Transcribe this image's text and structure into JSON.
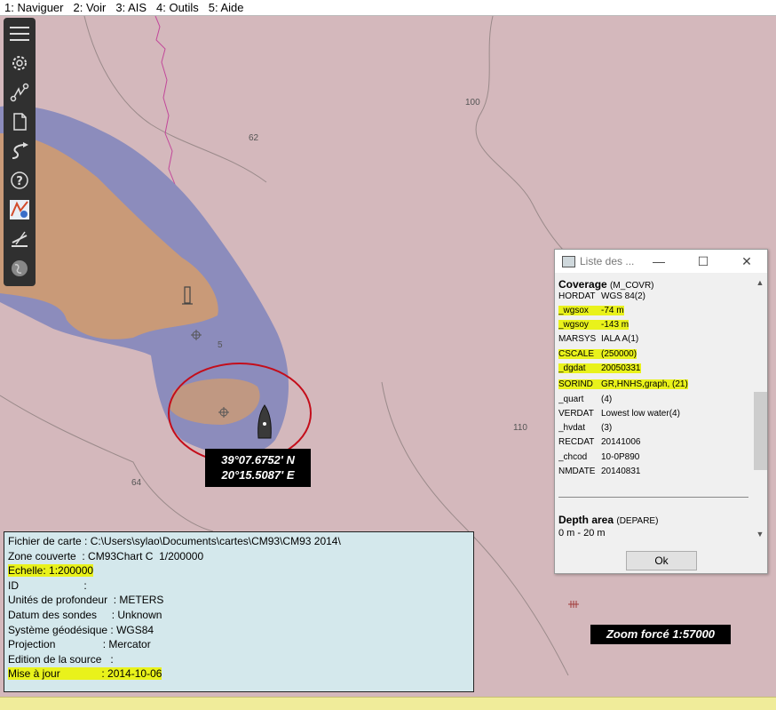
{
  "menu": [
    "1: Naviguer",
    "2: Voir",
    "3: AIS",
    "4: Outils",
    "5: Aide"
  ],
  "toolbar_icons": [
    "menu-icon",
    "settings-icon",
    "route-icon",
    "document-icon",
    "track-icon",
    "help-icon",
    "colors-icon",
    "ais-icon",
    "globe-icon"
  ],
  "map": {
    "depths": [
      "100",
      "62",
      "5",
      "110",
      "64"
    ],
    "position": {
      "lat": "39°07.6752' N",
      "lon": "20°15.5087' E"
    },
    "zoom_label": "Zoom forcé 1:57000"
  },
  "chart_info": {
    "file": "Fichier de carte : C:\\Users\\sylao\\Documents\\cartes\\CM93\\CM93 2014\\",
    "zone": "Zone couverte  : CM93Chart C  1/200000",
    "scale_label": "Echelle: ",
    "scale_value": "1:200000",
    "id": "ID                      :",
    "depth_units": "Unités de profondeur  : METERS",
    "sounding_datum": "Datum des sondes     : Unknown",
    "geodetic_system": "Système géodésique : WGS84",
    "projection": "Projection                : Mercator",
    "source_edition": "Edition de la source   :",
    "update_label": "Mise à jour              : 2014-10-06"
  },
  "object_dialog": {
    "title": "Liste des ...",
    "coverage_title": "Coverage",
    "coverage_code": "(M_COVR)",
    "attributes": [
      {
        "key": "HORDAT",
        "value": "WGS 84(2)",
        "hl": false
      },
      {
        "key": "_wgsox",
        "value": "-74 m",
        "hl": true
      },
      {
        "key": "_wgsoy",
        "value": "-143 m",
        "hl": true
      },
      {
        "key": "MARSYS",
        "value": "IALA A(1)",
        "hl": false
      },
      {
        "key": "CSCALE",
        "value": "(250000)",
        "hl": true
      },
      {
        "key": "_dgdat",
        "value": "20050331",
        "hl": true
      },
      {
        "key": "SORIND",
        "value": "GR,HNHS,graph, (21)",
        "hl": true
      },
      {
        "key": "_quart",
        "value": "(4)",
        "hl": false
      },
      {
        "key": "VERDAT",
        "value": "Lowest low water(4)",
        "hl": false
      },
      {
        "key": "_hvdat",
        "value": "(3)",
        "hl": false
      },
      {
        "key": "RECDAT",
        "value": "20141006",
        "hl": false
      },
      {
        "key": "_chcod",
        "value": "10-0P890",
        "hl": false
      },
      {
        "key": "NMDATE",
        "value": "20140831",
        "hl": false
      }
    ],
    "depth_area_title": "Depth area",
    "depth_area_code": "(DEPARE)",
    "depth_area_range": "0 m - 20 m",
    "ok_label": "Ok"
  }
}
